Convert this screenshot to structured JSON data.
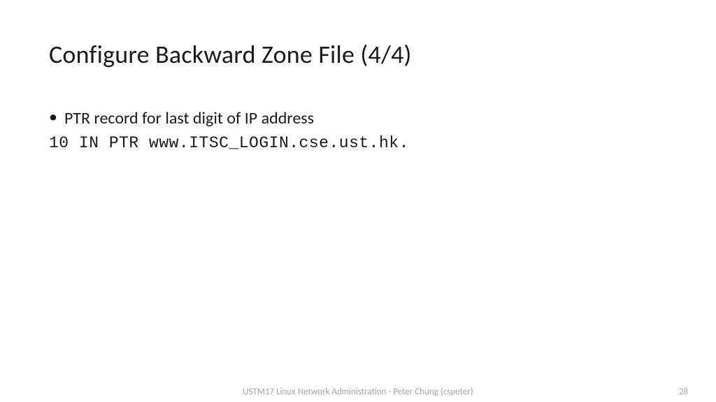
{
  "title": "Configure Backward Zone File (4/4)",
  "bullet": {
    "text": "PTR record for last digit of IP address"
  },
  "code": "10 IN PTR www.ITSC_LOGIN.cse.ust.hk.",
  "footer": {
    "text": "USTM17 Linux Network Administration - Peter Chung (cspeter)",
    "page": "28"
  }
}
